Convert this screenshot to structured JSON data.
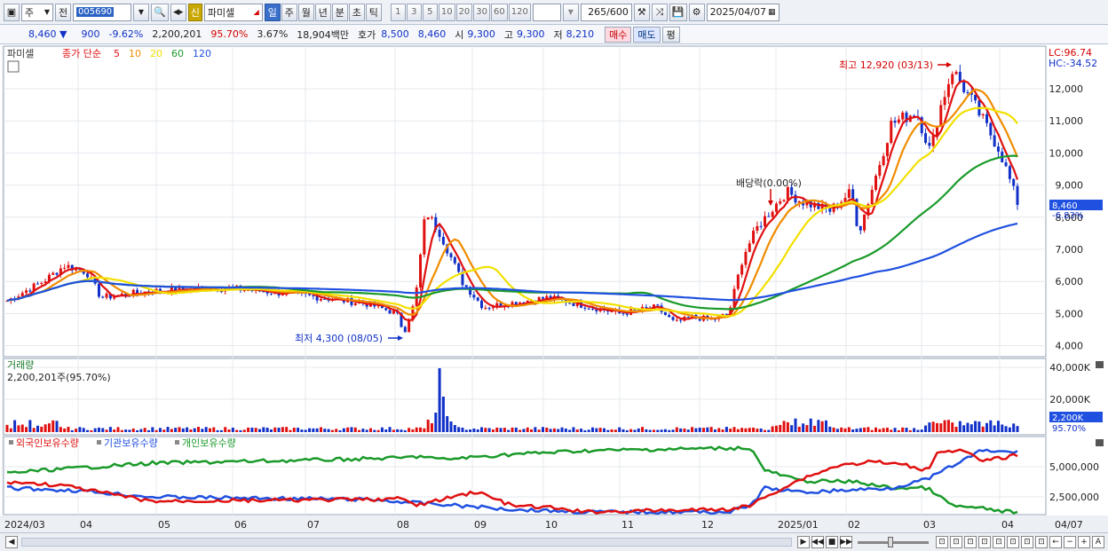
{
  "toolbar": {
    "market": "주",
    "prefix": "전",
    "code": "005690",
    "badge": "신",
    "name": "파미셀",
    "periods": [
      "일",
      "주",
      "월",
      "년",
      "분",
      "초",
      "틱"
    ],
    "active_period": "일",
    "intervals": [
      "1",
      "3",
      "5",
      "10",
      "20",
      "30",
      "60",
      "120"
    ],
    "count": "265",
    "count_total": "/600",
    "date": "2025/04/07"
  },
  "quote": {
    "price": "8,460",
    "arrow": "▼",
    "change": "900",
    "change_pct": "-9.62%",
    "volume": "2,200,201",
    "vol_ratio": "95.70%",
    "turnover": "3.67%",
    "amount": "18,904백만",
    "ask_label": "호가",
    "ask": "8,500",
    "bid": "8,460",
    "open_label": "시",
    "open": "9,300",
    "high_label": "고",
    "high": "9,300",
    "low_label": "저",
    "low": "8,210",
    "buy": "매수",
    "sell": "매도",
    "eval": "평"
  },
  "price_panel": {
    "name": "파미셀",
    "ma_title": "종가 단순",
    "ma_periods": [
      "5",
      "10",
      "20",
      "60",
      "120"
    ],
    "ma_colors": [
      "#e01010",
      "#f08c00",
      "#f2e000",
      "#1a9a2a",
      "#2050e0"
    ],
    "lc": "LC:96.74",
    "hc": "HC:-34.52",
    "y_ticks": [
      "12,000",
      "11,000",
      "10,000",
      "9,000",
      "8,000",
      "7,000",
      "6,000",
      "5,000",
      "4,000"
    ],
    "high_label": "최고 12,920 (03/13)",
    "low_label": "최저 4,300 (08/05)",
    "dividend_label": "배당락(0.00%)",
    "last_price": "8,460",
    "last_pct": "-6.83%"
  },
  "volume_panel": {
    "title": "거래량",
    "value": "2,200,201주(95.70%)",
    "y_ticks": [
      "40,000K",
      "20,000K"
    ],
    "last": "2,200K",
    "last_pct": "95.70%"
  },
  "holdings_panel": {
    "series": [
      "외국인보유수량",
      "기관보유수량",
      "개인보유수량"
    ],
    "series_colors": [
      "#e01010",
      "#2050e0",
      "#1a9a2a"
    ],
    "y_ticks": [
      "5,000,000",
      "2,500,000"
    ]
  },
  "x_axis": [
    "2024/03",
    "04",
    "05",
    "06",
    "07",
    "08",
    "09",
    "10",
    "11",
    "12",
    "2025/01",
    "02",
    "03",
    "04",
    "04/07"
  ]
}
